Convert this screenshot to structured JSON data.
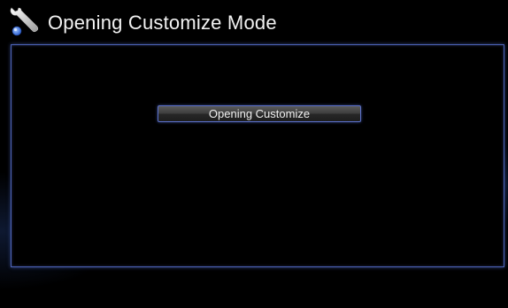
{
  "header": {
    "title": "Opening Customize Mode",
    "icon": "wrench-icon"
  },
  "menu": {
    "items": [
      {
        "label": "Opening Customize",
        "selected": true
      }
    ]
  },
  "colors": {
    "background": "#000000",
    "panel_border": "#4d63b8",
    "title_text": "#f2f2f2",
    "button_text": "#f0f0f0"
  }
}
